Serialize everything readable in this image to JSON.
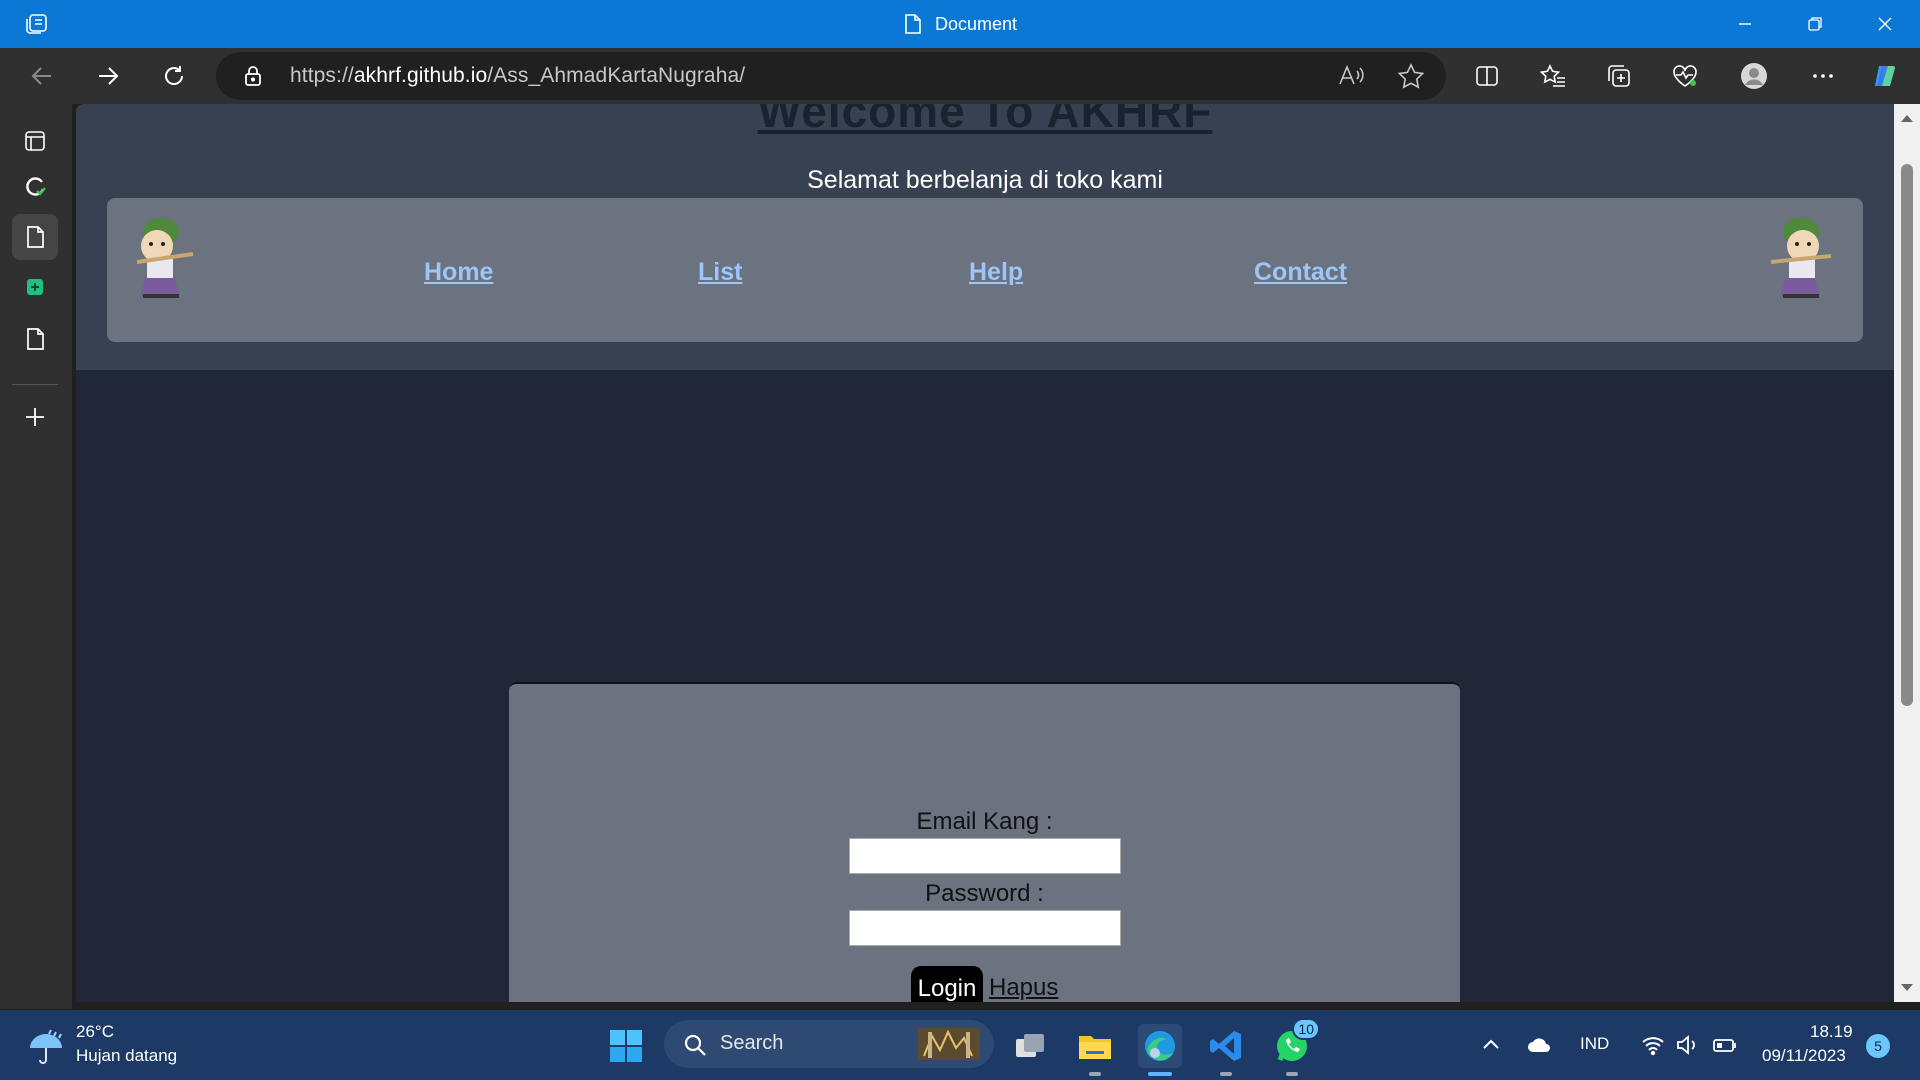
{
  "window": {
    "title": "Document",
    "controls": [
      "minimize",
      "restore",
      "close"
    ]
  },
  "addressbar": {
    "scheme": "https://",
    "host": "akhrf.github.io",
    "path": "/Ass_AhmadKartaNugraha/"
  },
  "page": {
    "heading": "Welcome To AKHRF",
    "subtitle": "Selamat berbelanja di toko kami",
    "nav": [
      "Home",
      "List",
      "Help",
      "Contact"
    ],
    "form": {
      "email_label": "Email Kang :",
      "email_value": "",
      "password_label": "Password :",
      "password_value": "",
      "login_label": "Login",
      "reset_label": "Hapus"
    }
  },
  "taskbar": {
    "weather_temp": "26°C",
    "weather_desc": "Hujan datang",
    "search_placeholder": "Search",
    "whatsapp_badge": "10",
    "language": "IND",
    "time": "18.19",
    "date": "09/11/2023",
    "notification_count": "5"
  },
  "colors": {
    "titlebar": "#0a78d4",
    "page_bg": "#202838",
    "header_bg": "#374152",
    "card_bg": "#6b7280",
    "link": "#9ec5f8",
    "taskbar": "#1d3a66"
  }
}
